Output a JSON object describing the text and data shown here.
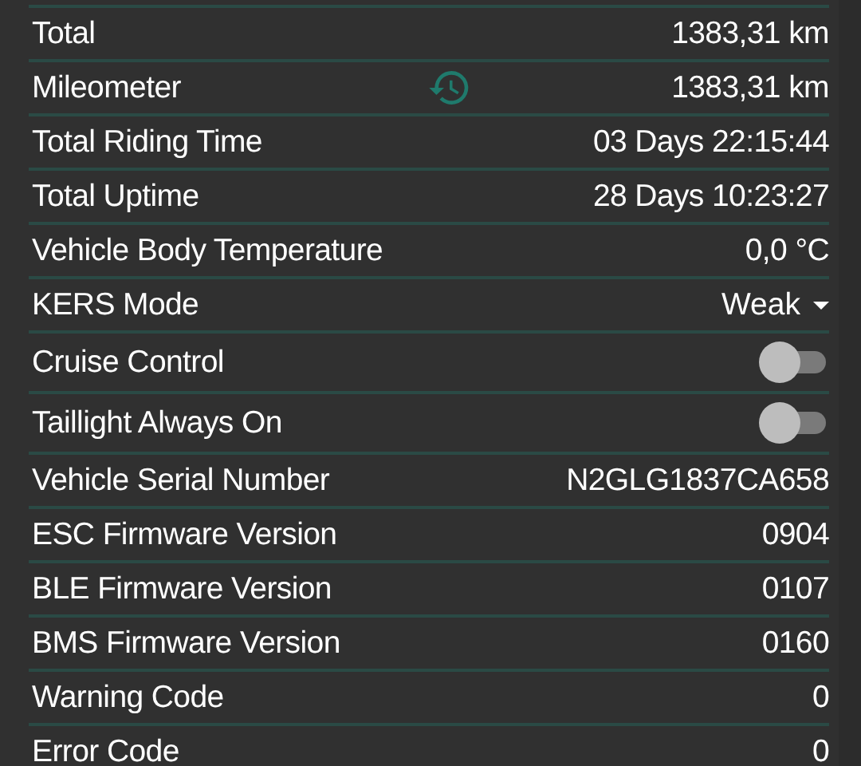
{
  "rows": [
    {
      "kind": "text",
      "label": "Total",
      "value": "1383,31 km"
    },
    {
      "kind": "reset",
      "label": "Mileometer",
      "value": "1383,31 km"
    },
    {
      "kind": "text",
      "label": "Total Riding Time",
      "value": "03 Days 22:15:44"
    },
    {
      "kind": "text",
      "label": "Total Uptime",
      "value": "28 Days 10:23:27"
    },
    {
      "kind": "text",
      "label": "Vehicle Body Temperature",
      "value": "0,0 °C"
    },
    {
      "kind": "dropdown",
      "label": "KERS Mode",
      "value": "Weak"
    },
    {
      "kind": "toggle",
      "label": "Cruise Control",
      "on": false
    },
    {
      "kind": "toggle",
      "label": "Taillight Always On",
      "on": false
    },
    {
      "kind": "text",
      "label": "Vehicle Serial Number",
      "value": "N2GLG1837CA658"
    },
    {
      "kind": "text",
      "label": "ESC Firmware Version",
      "value": "0904"
    },
    {
      "kind": "text",
      "label": "BLE Firmware Version",
      "value": "0107"
    },
    {
      "kind": "text",
      "label": "BMS Firmware Version",
      "value": "0160"
    },
    {
      "kind": "text",
      "label": "Warning Code",
      "value": "0"
    },
    {
      "kind": "text",
      "label": "Error Code",
      "value": "0"
    }
  ]
}
